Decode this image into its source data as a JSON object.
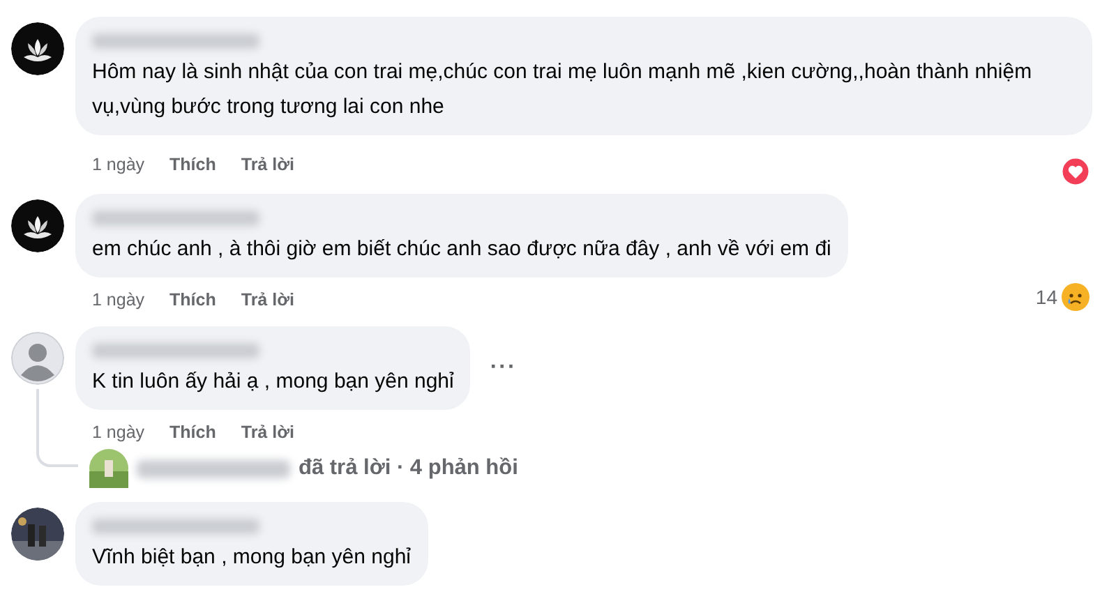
{
  "comments": [
    {
      "avatar": {
        "kind": "lotus"
      },
      "text": "Hôm nay là sinh nhật của con trai mẹ,chúc con trai mẹ luôn mạnh mẽ ,kien cường,,hoàn thành nhiệm vụ,vùng bước trong tương lai con nhe",
      "actions": {
        "time": "1 ngày",
        "like": "Thích",
        "reply": "Trả lời"
      },
      "reaction": {
        "kind": "love"
      }
    },
    {
      "avatar": {
        "kind": "lotus"
      },
      "text": "em chúc anh , à thôi giờ em biết chúc anh sao được nữa đây , anh về với em đi",
      "actions": {
        "time": "1 ngày",
        "like": "Thích",
        "reply": "Trả lời"
      },
      "reaction": {
        "kind": "sad",
        "count": "14"
      }
    },
    {
      "avatar": {
        "kind": "default"
      },
      "text": "K tin luôn ấy hải ạ , mong bạn yên nghỉ",
      "more": "···",
      "actions": {
        "time": "1 ngày",
        "like": "Thích",
        "reply": "Trả lời"
      },
      "replies": {
        "summary": "đã trả lời · 4 phản hồi"
      }
    },
    {
      "avatar": {
        "kind": "photo"
      },
      "text": "Vĩnh biệt bạn , mong bạn yên nghỉ"
    }
  ]
}
